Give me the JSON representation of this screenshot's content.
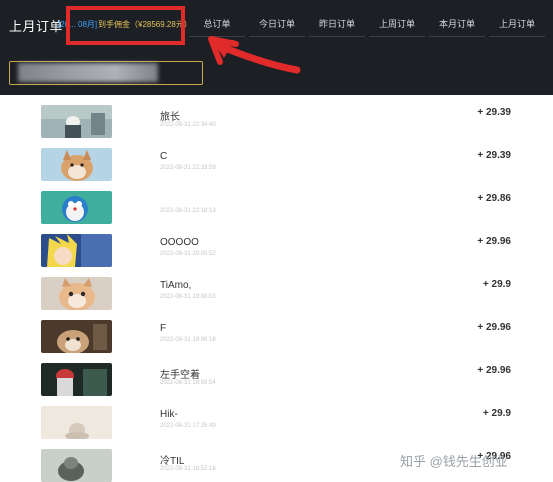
{
  "header": {
    "title": "上月订单",
    "date_range": "[20... 08月]",
    "earning": "到手佣金（¥28569.28元）"
  },
  "tabs": [
    {
      "label": "总订单"
    },
    {
      "label": "今日订单"
    },
    {
      "label": "昨日订单"
    },
    {
      "label": "上周订单"
    },
    {
      "label": "本月订单"
    },
    {
      "label": "上月订单"
    }
  ],
  "orders": [
    {
      "name": "旅长",
      "time": "2022-08-31 22:34:40",
      "amount": "+ 29.39"
    },
    {
      "name": "C",
      "time": "2022-08-31 22:33:59",
      "amount": "+ 29.39"
    },
    {
      "name": "",
      "time": "2022-08-31 22:18:13",
      "amount": "+ 29.86"
    },
    {
      "name": "OOOOO",
      "time": "2022-08-31 20:05:52",
      "amount": "+ 29.96"
    },
    {
      "name": "TiAmo,",
      "time": "2022-08-31 19:08:03",
      "amount": "+ 29.9"
    },
    {
      "name": "F",
      "time": "2022-08-31 19:06:18",
      "amount": "+ 29.96"
    },
    {
      "name": "左手空着",
      "time": "2022-08-31 18:59:54",
      "amount": "+ 29.96"
    },
    {
      "name": "Hik-",
      "time": "2022-08-31 17:25:49",
      "amount": "+ 29.9"
    },
    {
      "name": "冷TIL",
      "time": "2022-08-31 16:52:18",
      "amount": "+ 29.96"
    }
  ],
  "watermark": "知乎 @钱先生创业",
  "colors": {
    "header_bg": "#1c1f24",
    "highlight": "#e12a2a",
    "earning": "#e8c45a",
    "date": "#3fa2ff"
  }
}
